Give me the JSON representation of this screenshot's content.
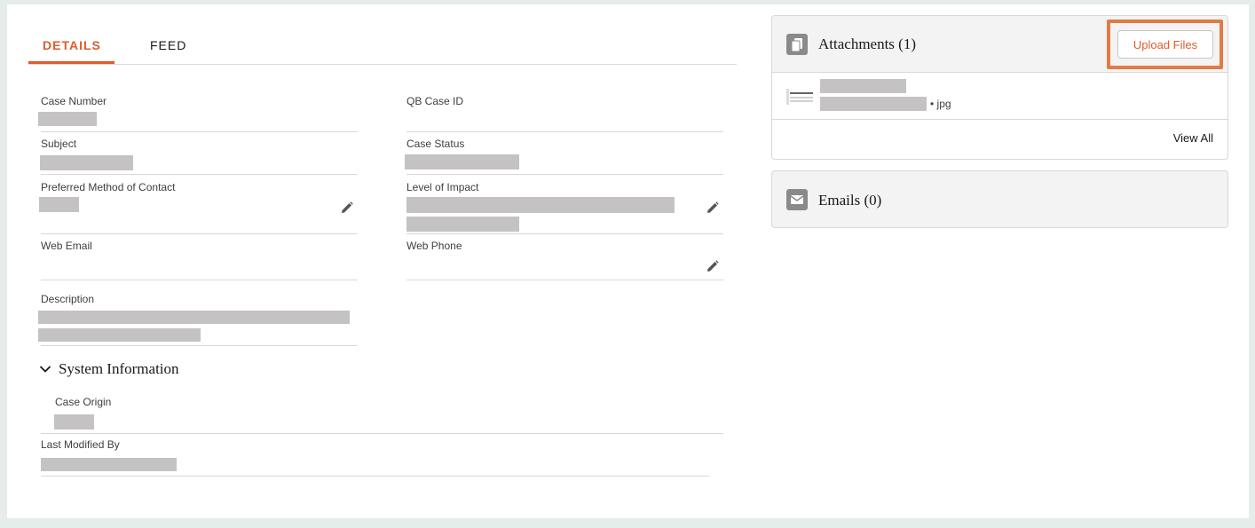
{
  "tabs": [
    {
      "label": "DETAILS",
      "active": true
    },
    {
      "label": "FEED",
      "active": false
    }
  ],
  "details": {
    "case_number_label": "Case Number",
    "qb_case_id_label": "QB Case ID",
    "subject_label": "Subject",
    "case_status_label": "Case Status",
    "preferred_contact_label": "Preferred Method of Contact",
    "level_of_impact_label": "Level of Impact",
    "web_email_label": "Web Email",
    "web_phone_label": "Web Phone",
    "description_label": "Description"
  },
  "system_information": {
    "title": "System Information",
    "case_origin_label": "Case Origin",
    "last_modified_label": "Last Modified By"
  },
  "attachments": {
    "title": "Attachments (1)",
    "upload_label": "Upload Files",
    "file_ext": "• jpg",
    "view_all_label": "View All"
  },
  "emails": {
    "title": "Emails (0)"
  },
  "colors": {
    "accent": "#e15b2b",
    "highlight_border": "#e07b45",
    "redaction": "#c4c2c3"
  }
}
